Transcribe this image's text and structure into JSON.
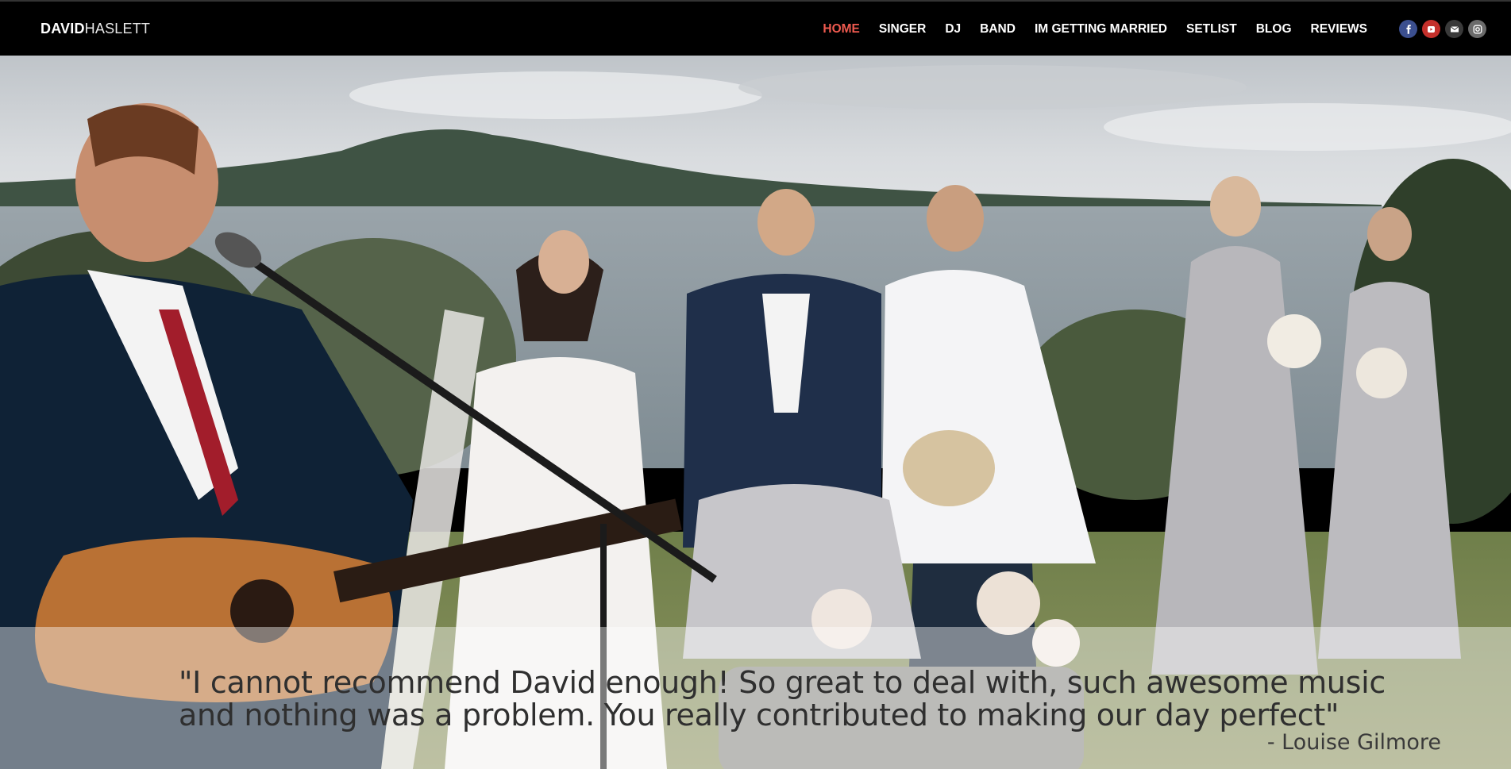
{
  "brand": {
    "logo_bold": "DAVID",
    "logo_light": "HASLETT"
  },
  "nav": {
    "items": [
      {
        "label": "HOME",
        "active": true
      },
      {
        "label": "SINGER"
      },
      {
        "label": "DJ"
      },
      {
        "label": "BAND"
      },
      {
        "label": "IM GETTING MARRIED"
      },
      {
        "label": "SETLIST"
      },
      {
        "label": "BLOG"
      },
      {
        "label": "REVIEWS"
      }
    ]
  },
  "social": [
    {
      "name": "facebook-icon",
      "color": "#3b4f8f"
    },
    {
      "name": "youtube-icon",
      "color": "#c4302b"
    },
    {
      "name": "email-icon",
      "color": "#3a3a3a"
    },
    {
      "name": "instagram-icon",
      "color": "#6b6b6b"
    }
  ],
  "hero": {
    "quote": "\"I cannot recommend David enough! So great to deal with, such awesome music and nothing was a problem. You really contributed to making our day perfect\"",
    "author": "- Louise Gilmore"
  },
  "colors": {
    "active_nav": "#ef5a4f",
    "topbar": "#000000"
  }
}
